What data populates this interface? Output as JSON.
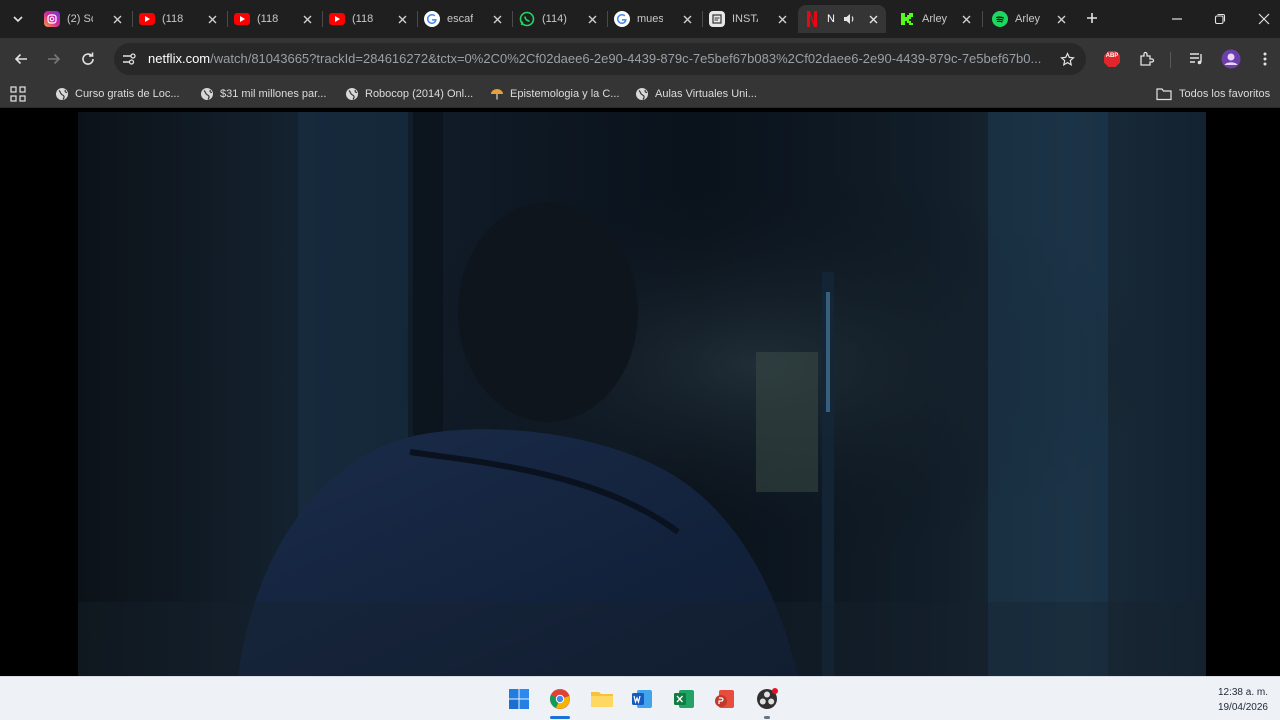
{
  "browser": {
    "tabs": [
      {
        "title": "(2) Sc",
        "icon": "instagram-icon",
        "active": false
      },
      {
        "title": "(118",
        "icon": "youtube-icon",
        "active": false
      },
      {
        "title": "(118",
        "icon": "youtube-icon",
        "active": false
      },
      {
        "title": "(118",
        "icon": "youtube-icon",
        "active": false
      },
      {
        "title": "escaf",
        "icon": "google-icon",
        "active": false
      },
      {
        "title": "(114)",
        "icon": "whatsapp-icon",
        "active": false
      },
      {
        "title": "mues",
        "icon": "google-icon",
        "active": false
      },
      {
        "title": "INSTA",
        "icon": "document-icon",
        "active": false
      },
      {
        "title": "N",
        "icon": "netflix-icon",
        "active": true
      },
      {
        "title": "Arley",
        "icon": "kick-icon",
        "active": false
      },
      {
        "title": "Arley",
        "icon": "spotify-icon",
        "active": false
      }
    ],
    "address": {
      "host": "netflix.com",
      "path": "/watch/81043665?trackId=284616272&tctx=0%2C0%2Cf02daee6-2e90-4439-879c-7e5bef67b083%2Cf02daee6-2e90-4439-879c-7e5bef67b0..."
    },
    "bookmarks": [
      {
        "label": "Curso gratis de Loc...",
        "icon": "globe-icon"
      },
      {
        "label": "$31 mil millones par...",
        "icon": "globe-icon"
      },
      {
        "label": "Robocop (2014) Onl...",
        "icon": "globe-icon"
      },
      {
        "label": "Epistemologia y la C...",
        "icon": "umbrella-icon"
      },
      {
        "label": "Aulas Virtuales Uni...",
        "icon": "globe-icon"
      }
    ],
    "all_bookmarks_label": "Todos los favoritos",
    "extension_badge": "ABP"
  },
  "taskbar": {
    "apps": [
      "windows-start-icon",
      "chrome-icon",
      "file-explorer-icon",
      "word-icon",
      "excel-icon",
      "pdf-icon",
      "obs-icon"
    ],
    "time": "12:38 a. m.",
    "date": "19/04/2026"
  },
  "colors": {
    "tab_strip": "#1f1f1f",
    "toolbar": "#353535",
    "omnibox": "#282828",
    "taskbar": "#eef1f6",
    "netflix_red": "#e50914"
  }
}
